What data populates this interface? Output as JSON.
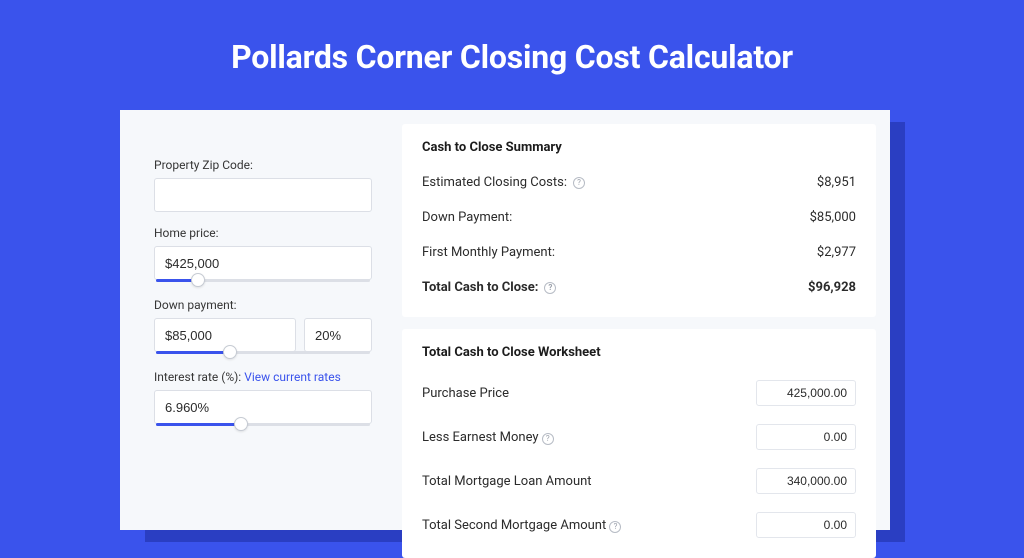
{
  "title": "Pollards Corner Closing Cost Calculator",
  "inputs": {
    "zip": {
      "label": "Property Zip Code:",
      "value": ""
    },
    "home_price": {
      "label": "Home price:",
      "value": "$425,000",
      "slider_pct": 20
    },
    "down_payment": {
      "label": "Down payment:",
      "value": "$85,000",
      "pct_value": "20%",
      "slider_pct": 35
    },
    "interest_rate": {
      "label": "Interest rate (%):",
      "link_text": "View current rates",
      "value": "6.960%",
      "slider_pct": 40
    }
  },
  "summary": {
    "heading": "Cash to Close Summary",
    "rows": [
      {
        "label": "Estimated Closing Costs:",
        "help": true,
        "value": "$8,951"
      },
      {
        "label": "Down Payment:",
        "help": false,
        "value": "$85,000"
      },
      {
        "label": "First Monthly Payment:",
        "help": false,
        "value": "$2,977"
      }
    ],
    "total": {
      "label": "Total Cash to Close:",
      "help": true,
      "value": "$96,928"
    }
  },
  "worksheet": {
    "heading": "Total Cash to Close Worksheet",
    "rows": [
      {
        "label": "Purchase Price",
        "help": false,
        "value": "425,000.00"
      },
      {
        "label": "Less Earnest Money",
        "help": true,
        "value": "0.00"
      },
      {
        "label": "Total Mortgage Loan Amount",
        "help": false,
        "value": "340,000.00"
      },
      {
        "label": "Total Second Mortgage Amount",
        "help": true,
        "value": "0.00"
      }
    ]
  }
}
